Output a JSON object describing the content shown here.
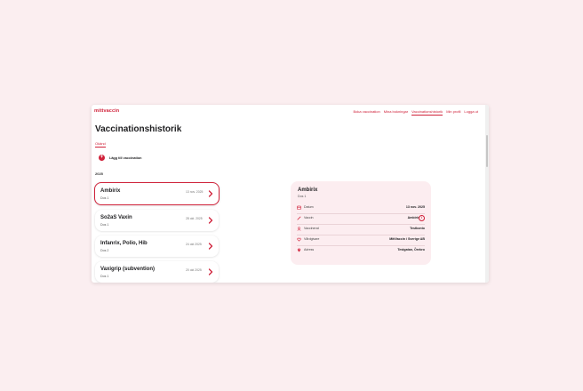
{
  "app": {
    "logo": "mittvaccin"
  },
  "nav": {
    "items": [
      {
        "label": "Boka vaccination",
        "active": false
      },
      {
        "label": "Mina bokningar",
        "active": false
      },
      {
        "label": "Vaccinationshistorik",
        "active": true
      },
      {
        "label": "Min profil",
        "active": false
      },
      {
        "label": "Logga ut",
        "active": false
      }
    ]
  },
  "page": {
    "title": "Vaccinationshistorik",
    "tab": "Okänd",
    "add_label": "Lägg till vaccination",
    "add_symbol": "+",
    "year": "2025"
  },
  "vaccinations": [
    {
      "name": "Ambirix",
      "dose": "Dos 1",
      "date": "13 nov. 2025",
      "selected": true
    },
    {
      "name": "So2aS Vaxin",
      "dose": "Dos 1",
      "date": "28 okt. 2025",
      "selected": false
    },
    {
      "name": "Infanrix, Polio, Hib",
      "dose": "Dos 2",
      "date": "24 okt 2025",
      "selected": false
    },
    {
      "name": "Vaxigrip (subvention)",
      "dose": "Dos 1",
      "date": "20 okt 2025",
      "selected": false
    }
  ],
  "detail": {
    "title": "Ambirix",
    "dose": "Dos 1",
    "rows": [
      {
        "icon": "calendar-icon",
        "label": "Datum",
        "value": "13 nov. 2025"
      },
      {
        "icon": "syringe-icon",
        "label": "Vaccin",
        "value": "Ambirix",
        "info": "i"
      },
      {
        "icon": "user-icon",
        "label": "Vaccinerat",
        "value": "Testkonto"
      },
      {
        "icon": "heart-icon",
        "label": "Vårdgivare",
        "value": "MittVaccin i Sverige AB"
      },
      {
        "icon": "location-pin-icon",
        "label": "Adress",
        "value": "Testgatan, Örebro"
      }
    ]
  },
  "colors": {
    "accent": "#d0223a",
    "background": "#fbeef0",
    "detail_bg": "#fcedf0"
  }
}
